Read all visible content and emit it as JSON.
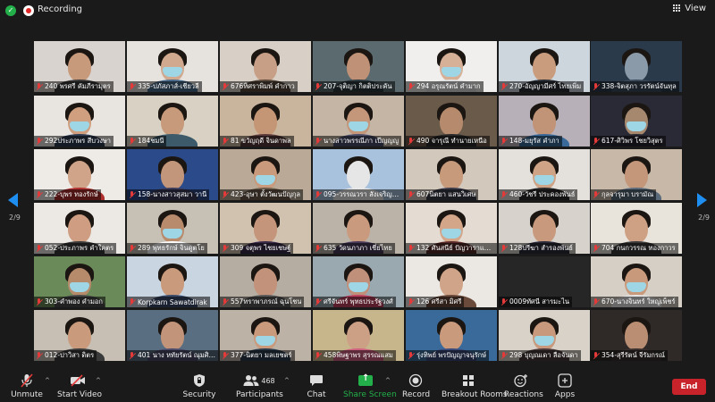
{
  "topbar": {
    "recording_label": "Recording",
    "view_label": "View"
  },
  "pagination": {
    "left": "2/9",
    "right": "2/9"
  },
  "toolbar": {
    "unmute": "Unmute",
    "start_video": "Start Video",
    "security": "Security",
    "participants": "Participants",
    "participants_count": "468",
    "chat": "Chat",
    "share_screen": "Share Screen",
    "record": "Record",
    "breakout_rooms": "Breakout Rooms",
    "reactions": "Reactions",
    "apps": "Apps",
    "end": "End"
  },
  "colors": {
    "accent_blue": "#1f8ef1",
    "share_green": "#23b04a",
    "end_red": "#c8232b",
    "mute_red": "#e43a3a"
  },
  "participants": [
    {
      "name": "240 พรศรี คัมภีรามุตร",
      "bg": "#d9d3cf",
      "skin": "#c89a7c",
      "body": "#3d3a3a"
    },
    {
      "name": "335-ปภัสภาส์-เชียวลี",
      "bg": "#e6e2de",
      "skin": "#d0a98e",
      "body": "#4a6a8a"
    },
    {
      "name": "676ทิศราพิมพ์ คำกาว",
      "bg": "#d8d0c6",
      "skin": "#c79f86",
      "body": "#5a4a3d"
    },
    {
      "name": "207-จุติญา กิตติประคัน",
      "bg": "#5a6a6e",
      "skin": "#bf9277",
      "body": "#2e3a3f"
    },
    {
      "name": "294 อรุณรัตน์ คำมาก",
      "bg": "#f0efee",
      "skin": "#d6b197",
      "body": "#e0e0e0"
    },
    {
      "name": "270-อัญญามีศร์ ไทยเพิ่ม",
      "bg": "#cdd6dd",
      "skin": "#c99c7e",
      "body": "#2b2f38"
    },
    {
      "name": "338-จิตสุภา วรรัตน์จันทุล",
      "bg": "#2a3a4a",
      "skin": "#8a9aa8",
      "body": "#3a4a5a"
    },
    {
      "name": "292ประภาพร สีบวงษา",
      "bg": "#e8e4e0",
      "skin": "#cf9f80",
      "body": "#2f3c52"
    },
    {
      "name": "184ชมนี",
      "bg": "#d9d2c4",
      "skin": "#c69a7a",
      "body": "#3c5a6a"
    },
    {
      "name": "81 ขวัญฤดี จินดาพล",
      "bg": "#c9b59d",
      "skin": "#c59676",
      "body": "#5a3a3a"
    },
    {
      "name": "นางสาวพรรณีภา เปีญญญู",
      "bg": "#c4b5a5",
      "skin": "#c4977b",
      "body": "#4d4f6a"
    },
    {
      "name": "490 จารุณี ทำนายเหนือ",
      "bg": "#6a5a4a",
      "skin": "#b68a6c",
      "body": "#2a2a2a"
    },
    {
      "name": "148-มยุรัส คำภา",
      "bg": "#b8b0b8",
      "skin": "#c29477",
      "body": "#3a6a9a"
    },
    {
      "name": "617-ศิวิพร โชยวิสุตร",
      "bg": "#2a2a36",
      "skin": "#a6886e",
      "body": "#262630"
    },
    {
      "name": "222-บุพร ทองรักษ์",
      "bg": "#eeeae6",
      "skin": "#d0a488",
      "body": "#b03030"
    },
    {
      "name": "158-นางสาวสุสมา วานี",
      "bg": "#2a4a8a",
      "skin": "#c2967a",
      "body": "#3a3a5a"
    },
    {
      "name": "423-อุษา ตั้งวัฒนปัญกุล",
      "bg": "#b9a996",
      "skin": "#c99a7c",
      "body": "#6a5a4a"
    },
    {
      "name": "095-วรรณวรา สังเจริญพลัก",
      "bg": "#a8c2de",
      "skin": "#e6e6e6",
      "body": "#e8e8e8"
    },
    {
      "name": "607นิตยา แสนวิเศษ",
      "bg": "#d2c8bc",
      "skin": "#c79a7c",
      "body": "#3a3a4a"
    },
    {
      "name": "460-วัชรี ประคองพันธ์",
      "bg": "#e4e0dc",
      "skin": "#cfa386",
      "body": "#2a2a2a"
    },
    {
      "name": "กุลจารุมา บรามัณ",
      "bg": "#c8b8a8",
      "skin": "#c4967a",
      "body": "#5a6a7a"
    },
    {
      "name": "052-ประภาพร คำใคตร",
      "bg": "#ece8e4",
      "skin": "#cf9e82",
      "body": "#3a3a3a"
    },
    {
      "name": "289 พุทธรักษ์ จินดูตโย",
      "bg": "#c7c0b5",
      "skin": "#b88b6d",
      "body": "#ffffff"
    },
    {
      "name": "309 จตุพร ไชยเชษฐ์",
      "bg": "#d1c2b0",
      "skin": "#c4957a",
      "body": "#3a2a4a"
    },
    {
      "name": "635 วัดนภาภา เชี่ยไทย",
      "bg": "#bbb3a8",
      "skin": "#c99a7e",
      "body": "#4a3a5a"
    },
    {
      "name": "132 ศันสนีย์ ปัญวาราแนทร์",
      "bg": "#e4dcd2",
      "skin": "#d3a68a",
      "body": "#5a2a2a"
    },
    {
      "name": "128ปรีฆา สำรองพันธ์",
      "bg": "#d8d2cc",
      "skin": "#c8997c",
      "body": "#2a2a3a"
    },
    {
      "name": "704 กนกวรรณ ทองกาวร",
      "bg": "#e8e4dc",
      "skin": "#cfa184",
      "body": "#3a3a3a"
    },
    {
      "name": "303-คำพอง คำมอก",
      "bg": "#6a8a5a",
      "skin": "#b68b6c",
      "body": "#4a4a4a"
    },
    {
      "name": "Korpkarn Sawatdirak",
      "bg": "#c9d6e2",
      "skin": "#c99a7c",
      "body": "#3a4a6a"
    },
    {
      "name": "557ทราพาภรณ์ ฉุนโชน",
      "bg": "#b6ada2",
      "skin": "#c2937a",
      "body": "#5a5a5a"
    },
    {
      "name": "ศรีจันทร์ พุทธประรัฐวงศ์",
      "bg": "#9aa8b0",
      "skin": "#c0907a",
      "body": "#c04060"
    },
    {
      "name": "126 ศรีสา มิศรี",
      "bg": "#ebe7e3",
      "skin": "#d0a488",
      "body": "#6a4a3a"
    },
    {
      "name": "0009ทัศนี สารมะไน",
      "bg": "#262626",
      "skin": "#262626",
      "body": "#262626"
    },
    {
      "name": "670-นางจินทร์ ใหญ่เพ็ชร์",
      "bg": "#d6cfc6",
      "skin": "#c9997c",
      "body": "#e6e6e6"
    },
    {
      "name": "012-ปาวิสา ดิตร",
      "bg": "#c7bfb4",
      "skin": "#c99a7c",
      "body": "#3a3a3a"
    },
    {
      "name": "401 นาง หทัยรัตน์ ณุมศิรส",
      "bg": "#5a6e82",
      "skin": "#c2957a",
      "body": "#4a4a6a"
    },
    {
      "name": "377-นิตยา มลเยชตร์",
      "bg": "#bcb2a6",
      "skin": "#c99a7c",
      "body": "#2a3a4a"
    },
    {
      "name": "458พิษฐาพร สุรรณแสม",
      "bg": "#c7b58c",
      "skin": "#cca085",
      "body": "#d06080"
    },
    {
      "name": "รุ่งทิพย์ พรปัญญาจนุรักษ์",
      "bg": "#3a6a9a",
      "skin": "#c99a7c",
      "body": "#3a4a7a"
    },
    {
      "name": "298 บุญณเดา ลือจันดา",
      "bg": "#d9d2c8",
      "skin": "#c8997d",
      "body": "#4a3a3a"
    },
    {
      "name": "354-สุรีรัตน์ จีรัมกรณ์",
      "bg": "#2f2a28",
      "skin": "#b98e72",
      "body": "#3a3030"
    }
  ]
}
